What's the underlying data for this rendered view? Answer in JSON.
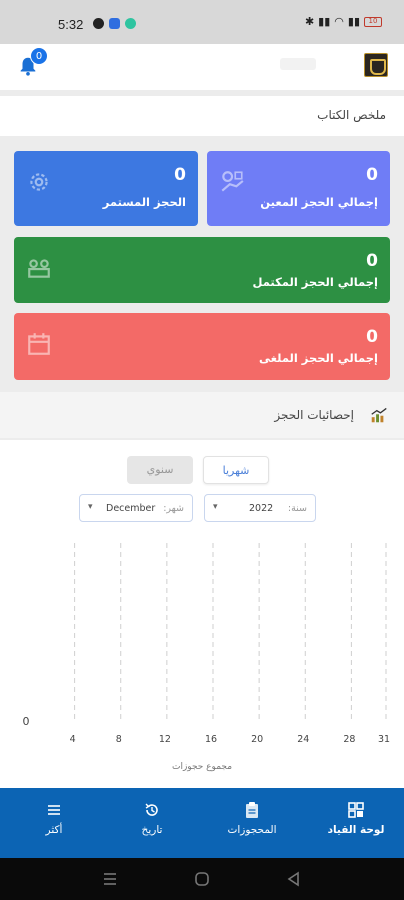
{
  "status_bar": {
    "time": "5:32",
    "battery": "10"
  },
  "header": {
    "notification_count": "0"
  },
  "summary": {
    "title": "ملخص الكتاب",
    "cards": {
      "ongoing": {
        "value": "0",
        "label": "الحجز المستمر",
        "color": "#3d78e1"
      },
      "assigned": {
        "value": "0",
        "label": "إجمالي الحجز المعين",
        "color": "#6f7df6"
      },
      "completed": {
        "value": "0",
        "label": "إجمالي الحجز المكتمل",
        "color": "#2d9043"
      },
      "cancelled": {
        "value": "0",
        "label": "إجمالي الحجز الملغى",
        "color": "#f36a67"
      }
    }
  },
  "stats": {
    "title": "إحصائيات الحجز",
    "tabs": {
      "monthly": "شهريا",
      "yearly": "سنوي",
      "active": "monthly"
    },
    "year_select": {
      "caption": "سنة:",
      "value": "2022"
    },
    "month_select": {
      "caption": "شهر:",
      "value": "December"
    }
  },
  "chart_data": {
    "type": "line",
    "x_ticks": [
      4,
      8,
      12,
      16,
      20,
      24,
      28,
      31
    ],
    "y_ticks": [
      0
    ],
    "x": [
      1,
      31
    ],
    "series": [
      {
        "values": [
          0,
          0
        ],
        "color": "#f29aa6"
      }
    ],
    "xlim": [
      1,
      31
    ],
    "ylim": [
      0,
      1
    ],
    "xlabel": "مجموع حجوزات",
    "ylabel": "",
    "grid": "vertical dashed",
    "accent_colors": [
      "#f29aa6",
      "#8a9ad8"
    ]
  },
  "bottom_nav": {
    "items": [
      {
        "id": "dashboard",
        "label": "لوحة القياد",
        "icon": "dashboard-icon",
        "active": true
      },
      {
        "id": "bookings",
        "label": "المحجوزات",
        "icon": "clipboard-icon",
        "active": false
      },
      {
        "id": "history",
        "label": "تاريخ",
        "icon": "history-icon",
        "active": false
      },
      {
        "id": "more",
        "label": "أكثر",
        "icon": "menu-icon",
        "active": false
      }
    ]
  }
}
